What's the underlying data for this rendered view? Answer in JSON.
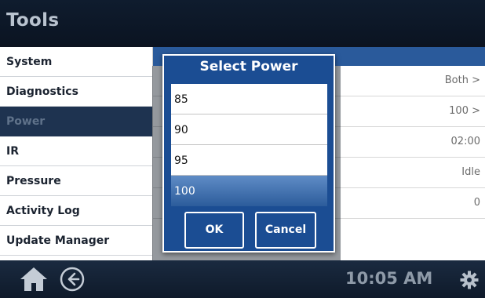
{
  "app": {
    "title": "Tools"
  },
  "sidebar": {
    "items": [
      {
        "label": "System"
      },
      {
        "label": "Diagnostics"
      },
      {
        "label": "Power"
      },
      {
        "label": "IR"
      },
      {
        "label": "Pressure"
      },
      {
        "label": "Activity Log"
      },
      {
        "label": "Update Manager"
      }
    ],
    "active_index": 2
  },
  "content": {
    "rows": [
      {
        "value": "Both >"
      },
      {
        "value": "100 >"
      },
      {
        "value": "02:00"
      },
      {
        "value": "Idle"
      },
      {
        "value": "0"
      }
    ]
  },
  "dialog": {
    "title": "Select Power",
    "options": [
      "85",
      "90",
      "95",
      "100"
    ],
    "selected": "100",
    "ok_label": "OK",
    "cancel_label": "Cancel"
  },
  "footer": {
    "time": "10:05 AM",
    "icons": [
      "home-icon",
      "back-icon",
      "gear-icon"
    ]
  },
  "colors": {
    "accent": "#1b4d93",
    "selected": "#2c5c9b",
    "title_bar": "#0f1c2e"
  }
}
